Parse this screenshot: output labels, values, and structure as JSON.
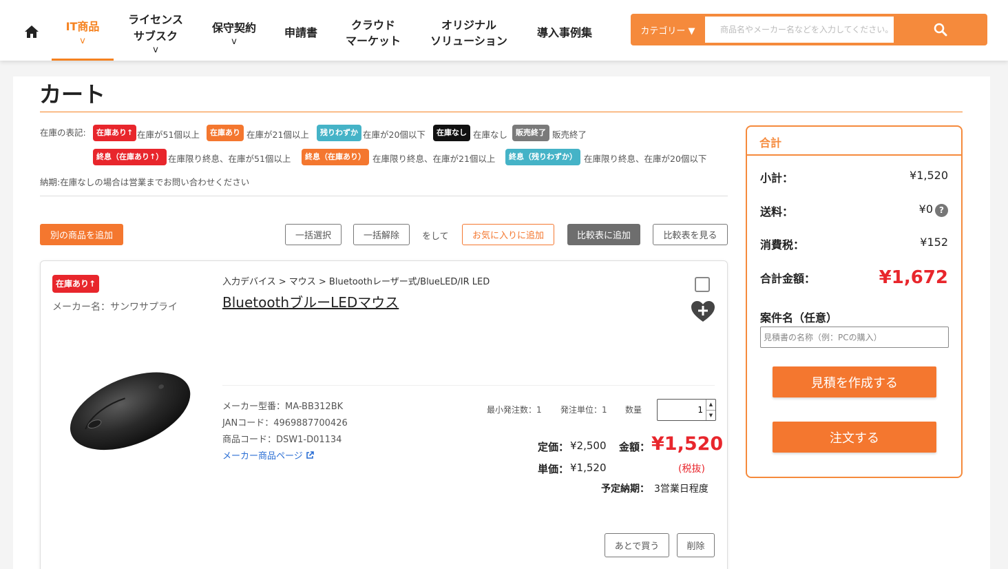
{
  "colors": {
    "accent": "#f4772f",
    "price_red": "#e8262c",
    "teal": "#45b3c7"
  },
  "header": {
    "nav": [
      {
        "line1": "IT商品",
        "line2": "",
        "chevron": "v"
      },
      {
        "line1": "ライセンス",
        "line2": "サブスク",
        "chevron": "v"
      },
      {
        "line1": "保守契約",
        "line2": "",
        "chevron": "v"
      },
      {
        "line1": "申請書",
        "line2": "",
        "chevron": ""
      },
      {
        "line1": "クラウド",
        "line2": "マーケット",
        "chevron": ""
      },
      {
        "line1": "オリジナル",
        "line2": "ソリューション",
        "chevron": ""
      },
      {
        "line1": "導入事例集",
        "line2": "",
        "chevron": ""
      }
    ],
    "category_label": "カテゴリー ▼",
    "search_placeholder": "商品名やメーカー名などを入力してください。",
    "icons": {
      "home": "home-icon",
      "search": "search-icon"
    }
  },
  "page": {
    "title": "カート",
    "legend": {
      "prefix": "在庫の表記:",
      "row1": [
        {
          "badge": "在庫あり↑",
          "desc": "在庫が51個以上"
        },
        {
          "badge": "在庫あり",
          "desc": "在庫が21個以上"
        },
        {
          "badge": "残りわずか",
          "desc": "在庫が20個以下"
        },
        {
          "badge": "在庫なし",
          "desc": "在庫なし"
        },
        {
          "badge": "販売終了",
          "desc": "販売終了"
        }
      ],
      "row2": [
        {
          "badge": "終息（在庫あり↑）",
          "desc": "在庫限り終息、在庫が51個以上"
        },
        {
          "badge": "終息（在庫あり）",
          "desc": "在庫限り終息、在庫が21個以上"
        },
        {
          "badge": "終息（残りわずか）",
          "desc": "在庫限り終息、在庫が20個以下"
        }
      ],
      "note": "納期:在庫なしの場合は営業までお問い合わせください"
    },
    "toolbar": {
      "add_other": "別の商品を追加",
      "select_all": "一括選択",
      "deselect_all": "一括解除",
      "then": "をして",
      "add_favorite": "お気に入りに追加",
      "add_compare": "比較表に追加",
      "view_compare": "比較表を見る"
    }
  },
  "item": {
    "stock_badge": "在庫あり↑",
    "maker": "メーカー名：サンワサプライ",
    "breadcrumb": "入力デバイス > マウス > Bluetoothレーザー式/BlueLED/IR LED",
    "name": "BluetoothブルーLEDマウス",
    "image_alt": "black-wireless-mouse",
    "model": "メーカー型番：MA-BB312BK",
    "jan": "JANコード：4969887700426",
    "code": "商品コード：DSW1-D01134",
    "maker_page": "メーカー商品ページ",
    "min_order": "最小発注数：1",
    "order_unit": "発注単位：1",
    "qty_label": "数量",
    "qty_value": "1",
    "list_price_label": "定価：",
    "list_price": "¥2,500",
    "amount_label": "金額：",
    "amount": "¥1,520",
    "unit_price_label": "単価：",
    "unit_price": "¥1,520",
    "tax_note": "(税抜)",
    "delivery_label": "予定納期：",
    "delivery": "3営業日程度",
    "buy_later": "あとで買う",
    "delete": "削除"
  },
  "summary": {
    "title": "合計",
    "subtotal_label": "小計：",
    "subtotal": "¥1,520",
    "shipping_label": "送料：",
    "shipping": "¥0",
    "tax_label": "消費税：",
    "tax": "¥152",
    "total_label": "合計金額：",
    "total": "¥1,672",
    "project_label": "案件名（任意）",
    "project_placeholder": "見積書の名称（例：PCの購入）",
    "estimate_btn": "見積を作成する",
    "order_btn": "注文する"
  }
}
